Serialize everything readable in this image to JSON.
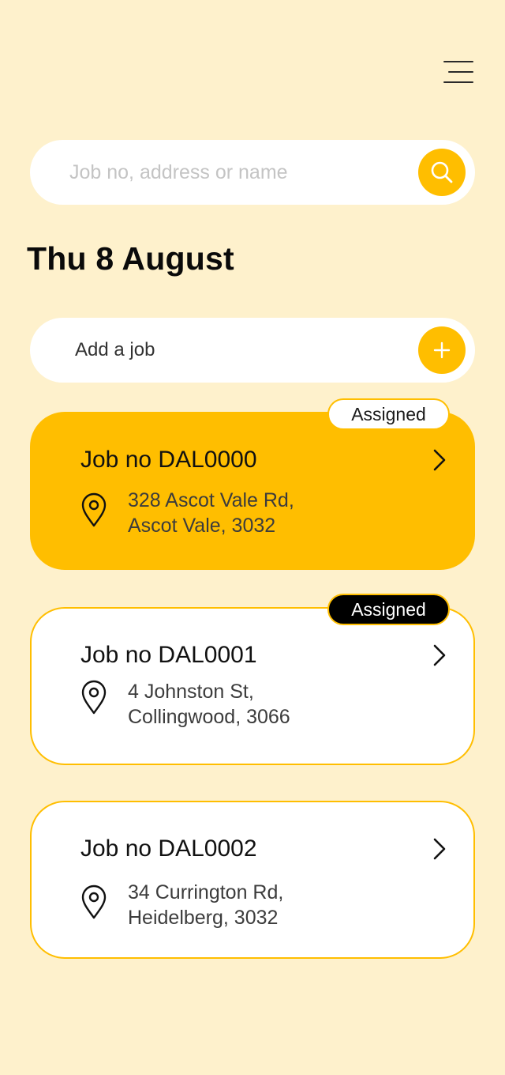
{
  "header": {
    "menu_icon": "hamburger-menu-icon"
  },
  "search": {
    "placeholder": "Job no, address or name",
    "value": "",
    "button_icon": "search-icon"
  },
  "date_heading": "Thu 8 August",
  "add_job": {
    "label": "Add a job",
    "button_icon": "plus-icon"
  },
  "colors": {
    "background": "#FEF1CC",
    "accent": "#FFBE00",
    "card": "#FFFFFF",
    "badge_dark": "#000000"
  },
  "jobs": [
    {
      "title": "Job no DAL0000",
      "address_line1": "328 Ascot Vale Rd,",
      "address_line2": "Ascot Vale, 3032",
      "badge": "Assigned",
      "badge_style": "light",
      "selected": true
    },
    {
      "title": "Job no DAL0001",
      "address_line1": "4 Johnston St,",
      "address_line2": "Collingwood, 3066",
      "badge": "Assigned",
      "badge_style": "dark",
      "selected": false
    },
    {
      "title": "Job no DAL0002",
      "address_line1": "34 Currington Rd,",
      "address_line2": "Heidelberg, 3032",
      "badge": "",
      "selected": false
    }
  ]
}
